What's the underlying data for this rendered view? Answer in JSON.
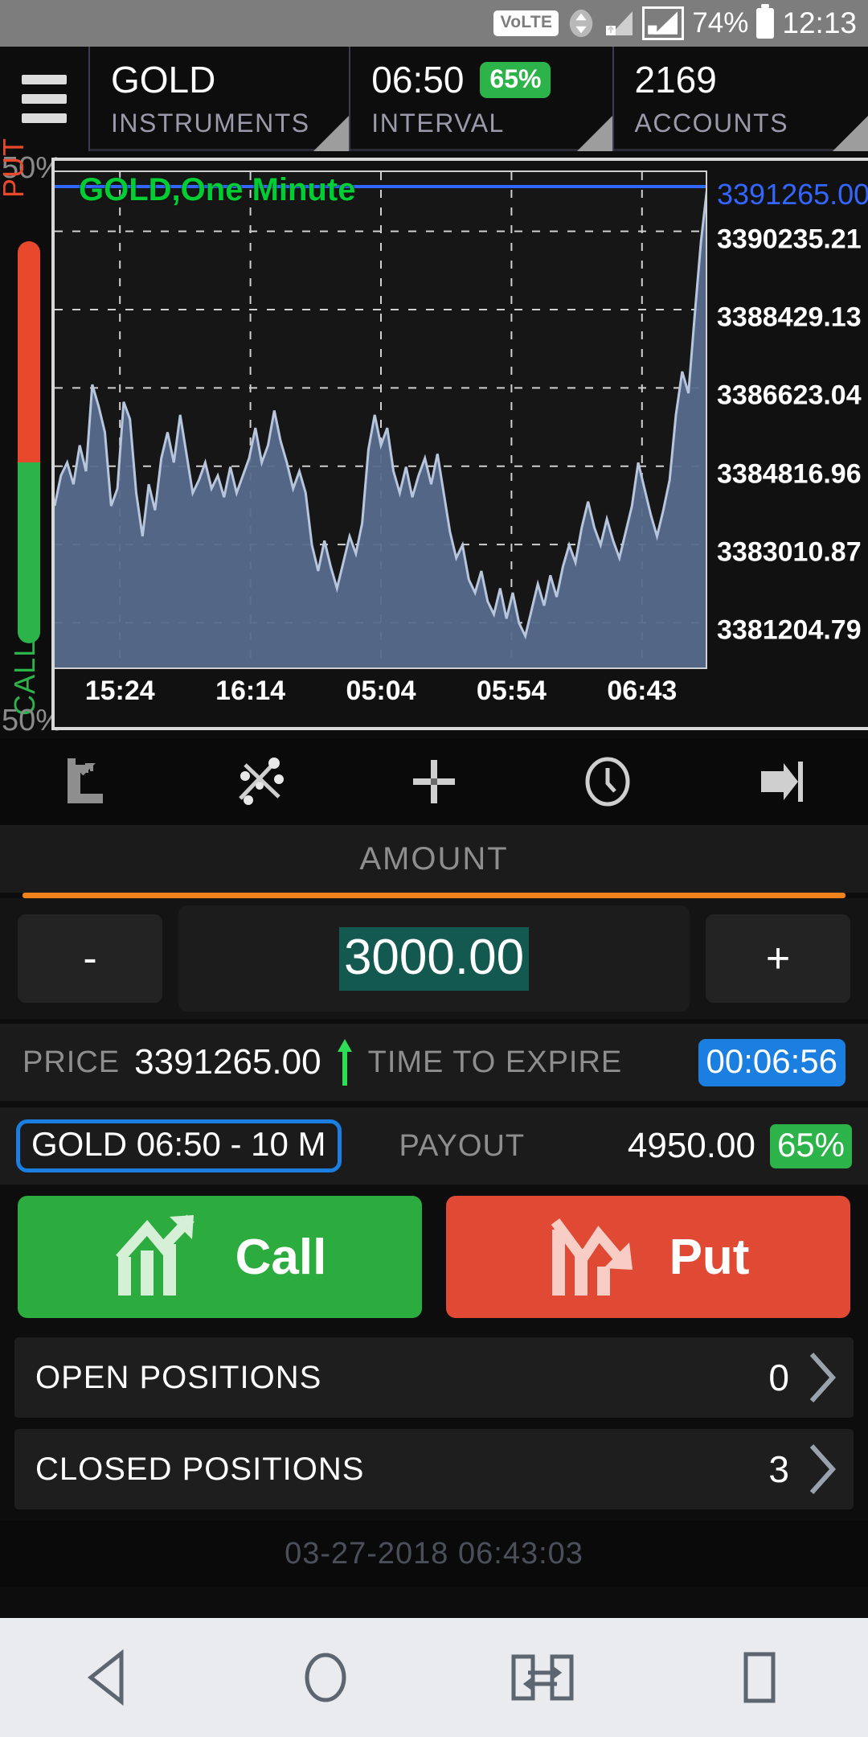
{
  "status_bar": {
    "volte": "VoLTE",
    "battery_percent": "74%",
    "time": "12:13",
    "icons": [
      "wifi-icon",
      "signal-icon",
      "signal-icon-2",
      "battery-icon"
    ]
  },
  "top_nav": {
    "menu_icon": "hamburger-menu-icon",
    "cells": [
      {
        "value": "GOLD",
        "label": "INSTRUMENTS",
        "badge": ""
      },
      {
        "value": "06:50",
        "label": "INTERVAL",
        "badge": "65%"
      },
      {
        "value": "2169",
        "label": "ACCOUNTS",
        "badge": ""
      }
    ]
  },
  "ratio_rail": {
    "top_percent": "50%",
    "bottom_percent": "50%",
    "put_label": "PUT",
    "call_label": "CALL",
    "put_color": "#e8492c",
    "call_color": "#2cb34a"
  },
  "chart_data": {
    "type": "area",
    "title": "GOLD,One Minute",
    "title_color": "#00cc33",
    "xlabel": "",
    "ylabel": "",
    "grid": true,
    "legend": "none",
    "current_price": "3391265.00",
    "current_price_color": "#3366ff",
    "y_ticks": [
      "3390235.21",
      "3388429.13",
      "3386623.04",
      "3384816.96",
      "3383010.87",
      "3381204.79"
    ],
    "y_tick_values": [
      3390235.21,
      3388429.13,
      3386623.04,
      3384816.96,
      3383010.87,
      3381204.79
    ],
    "ylim": [
      3380100,
      3391600
    ],
    "x_ticks": [
      "15:24",
      "16:14",
      "05:04",
      "05:54",
      "06:43"
    ],
    "series": [
      {
        "name": "GOLD",
        "values": [
          3383900,
          3384600,
          3384900,
          3384400,
          3385300,
          3384700,
          3386700,
          3386200,
          3385600,
          3383900,
          3384300,
          3386300,
          3385900,
          3384200,
          3383200,
          3384400,
          3383800,
          3385000,
          3385600,
          3384900,
          3386000,
          3385100,
          3384200,
          3384500,
          3384900,
          3384300,
          3384600,
          3384100,
          3384800,
          3384200,
          3384600,
          3385000,
          3385700,
          3384900,
          3385300,
          3386100,
          3385400,
          3384900,
          3384300,
          3384700,
          3384200,
          3383000,
          3382400,
          3383100,
          3382500,
          3382000,
          3382600,
          3383200,
          3382800,
          3383500,
          3385200,
          3386000,
          3385300,
          3385700,
          3384700,
          3384200,
          3384800,
          3384100,
          3384600,
          3385000,
          3384400,
          3385100,
          3384200,
          3383300,
          3382700,
          3383000,
          3382200,
          3381900,
          3382400,
          3381700,
          3381400,
          3382000,
          3381300,
          3381900,
          3381200,
          3380900,
          3381500,
          3382100,
          3381600,
          3382300,
          3381800,
          3382500,
          3383000,
          3382600,
          3383400,
          3384000,
          3383400,
          3383000,
          3383600,
          3383100,
          3382700,
          3383300,
          3383900,
          3384900,
          3384300,
          3383700,
          3383200,
          3383800,
          3384500,
          3386000,
          3387000,
          3386500,
          3388300,
          3390000,
          3391265
        ]
      }
    ],
    "reference_line": {
      "value": 3391265.0,
      "color": "#3366ff"
    },
    "area_fill": "#566a8c",
    "line_color": "#b7c6dd"
  },
  "chart_toolbar": {
    "items": [
      {
        "icon": "chart-type-icon"
      },
      {
        "icon": "indicators-icon"
      },
      {
        "icon": "crosshair-icon"
      },
      {
        "icon": "clock-icon"
      },
      {
        "icon": "jump-to-end-icon"
      }
    ]
  },
  "amount": {
    "header": "AMOUNT",
    "decrement_label": "-",
    "increment_label": "+",
    "value": "3000.00",
    "highlight_color": "#14594f",
    "rule_color": "#f0821e"
  },
  "price_row": {
    "price_label": "PRICE",
    "price_value": "3391265.00",
    "trend_icon": "arrow-up-icon",
    "expire_label": "TIME TO EXPIRE",
    "expire_value": "00:06:56",
    "expire_color": "#1a7fe0"
  },
  "contract_row": {
    "contract": "GOLD 06:50 - 10 M",
    "payout_label": "PAYOUT",
    "payout_value": "4950.00",
    "payout_badge": "65%"
  },
  "trade_buttons": {
    "call_label": "Call",
    "put_label": "Put",
    "call_color": "#2cab3e",
    "put_color": "#e04a35",
    "call_icon": "trend-up-icon",
    "put_icon": "trend-down-icon"
  },
  "positions": [
    {
      "label": "OPEN POSITIONS",
      "count": "0",
      "chevron": "chevron-right-icon"
    },
    {
      "label": "CLOSED POSITIONS",
      "count": "3",
      "chevron": "chevron-right-icon"
    }
  ],
  "footer": {
    "timestamp": "03-27-2018 06:43:03"
  },
  "android_nav": {
    "items": [
      {
        "icon": "back-icon"
      },
      {
        "icon": "home-icon"
      },
      {
        "icon": "app-switch-icon"
      },
      {
        "icon": "recents-icon"
      }
    ]
  }
}
